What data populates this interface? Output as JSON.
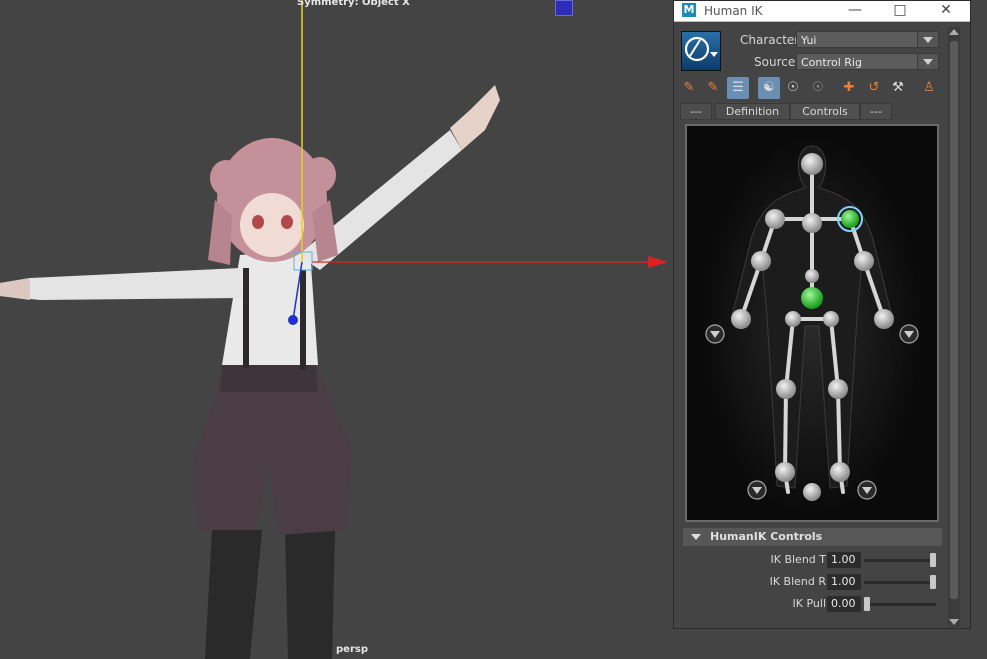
{
  "viewport": {
    "symmetry_label": "Symmetry: Object X",
    "camera_label": "persp"
  },
  "window": {
    "title": "Human IK",
    "app_icon": "maya-icon",
    "controls": [
      "minimize-icon",
      "maximize-icon",
      "close-icon"
    ]
  },
  "character": {
    "label": "Character:",
    "value": "Yui"
  },
  "source": {
    "label": "Source:",
    "value": "Control Rig"
  },
  "toolbar_icons": [
    "pin-brush-icon",
    "pin-brush-alt-icon",
    "full-body-icon",
    "body-part-icon",
    "stance-icon",
    "stance-alt-icon",
    "move-icon",
    "reset-icon",
    "key-icon",
    "character-icon"
  ],
  "tabs": [
    {
      "label": "---"
    },
    {
      "label": "Definition"
    },
    {
      "label": "Controls"
    },
    {
      "label": "---"
    }
  ],
  "active_tab": "Controls",
  "controls_section": {
    "title": "HumanIK Controls",
    "rows": [
      {
        "label": "IK Blend T",
        "value": "1.00",
        "level": 1.0
      },
      {
        "label": "IK Blend R",
        "value": "1.00",
        "level": 1.0
      },
      {
        "label": "IK Pull",
        "value": "0.00",
        "level": 0.0
      }
    ]
  },
  "colors": {
    "selected_effector": "#3ad23a",
    "effector": "#c9c9c9",
    "x_axis": "#e02020",
    "y_axis": "#e8d020",
    "active_tool": "#6b8fb3"
  }
}
